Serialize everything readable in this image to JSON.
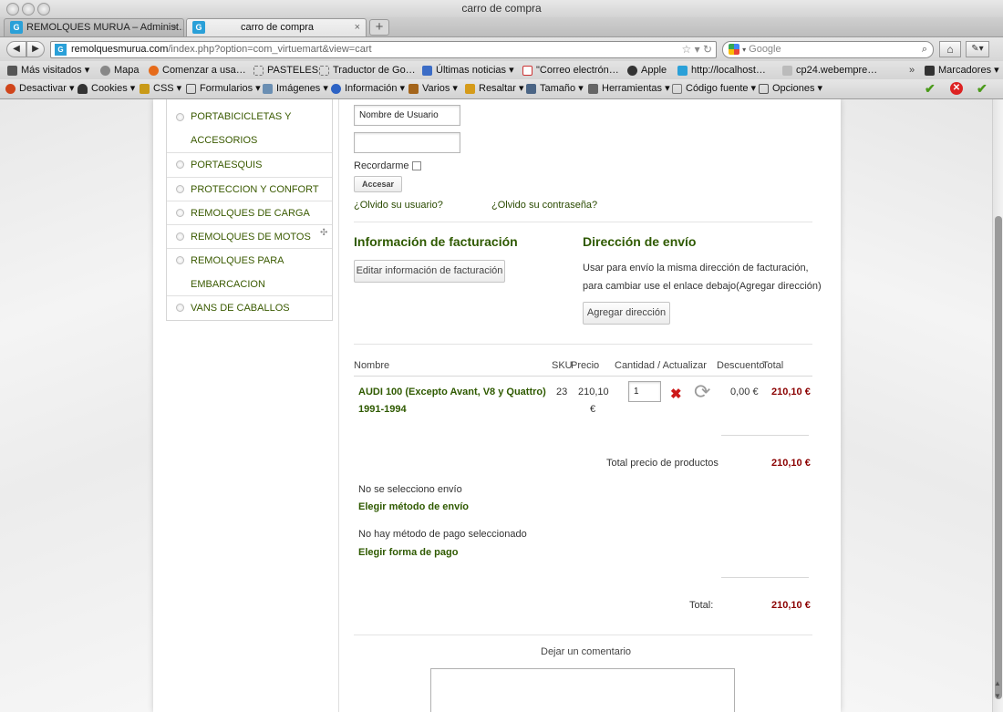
{
  "window": {
    "title": "carro de compra"
  },
  "tabs": [
    {
      "label": "REMOLQUES MURUA – Administ…",
      "favicon": "G"
    },
    {
      "label": "carro de compra",
      "favicon": "G"
    }
  ],
  "navbar": {
    "url_domain": "remolquesmurua.com",
    "url_path": "/index.php?option=com_virtuemart&view=cart",
    "search_placeholder": "Google"
  },
  "bookmarks": [
    {
      "label": "Más visitados ▾",
      "icon": "bookmarks-icon"
    },
    {
      "label": "Mapa",
      "icon": "globe-icon"
    },
    {
      "label": "Comenzar a usa…",
      "icon": "firefox-icon"
    },
    {
      "label": "PASTELES",
      "icon": "page-icon"
    },
    {
      "label": "Traductor de Go…",
      "icon": "page-icon"
    },
    {
      "label": "Últimas noticias ▾",
      "icon": "rss-icon"
    },
    {
      "label": "\"Correo electrón…",
      "icon": "gmail-icon"
    },
    {
      "label": "Apple",
      "icon": "apple-icon"
    },
    {
      "label": "http://localhost…",
      "icon": "g-icon"
    },
    {
      "label": "cp24.webempre…",
      "icon": "page-icon"
    },
    {
      "label": "Marcadores ▾",
      "icon": "bookmarks-folder-icon"
    }
  ],
  "devtoolbar": [
    {
      "label": "Desactivar ▾",
      "icon": "disable-icon"
    },
    {
      "label": "Cookies ▾",
      "icon": "person-icon"
    },
    {
      "label": "CSS ▾",
      "icon": "pencil-icon"
    },
    {
      "label": "Formularios ▾",
      "icon": "form-icon"
    },
    {
      "label": "Imágenes ▾",
      "icon": "image-icon"
    },
    {
      "label": "Información ▾",
      "icon": "info-icon"
    },
    {
      "label": "Varios ▾",
      "icon": "misc-icon"
    },
    {
      "label": "Resaltar ▾",
      "icon": "highlight-icon"
    },
    {
      "label": "Tamaño ▾",
      "icon": "resize-icon"
    },
    {
      "label": "Herramientas ▾",
      "icon": "tools-icon"
    },
    {
      "label": "Código fuente ▾",
      "icon": "source-icon"
    },
    {
      "label": "Opciones ▾",
      "icon": "options-icon"
    }
  ],
  "sidebar": {
    "items": [
      {
        "label": "PORTABICICLETAS Y ACCESORIOS"
      },
      {
        "label": "PORTAESQUIS"
      },
      {
        "label": "PROTECCION Y CONFORT"
      },
      {
        "label": "REMOLQUES DE CARGA"
      },
      {
        "label": "REMOLQUES DE MOTOS"
      },
      {
        "label": "REMOLQUES PARA EMBARCACION"
      },
      {
        "label": "VANS DE CABALLOS"
      }
    ]
  },
  "login": {
    "username_value": "Nombre de Usuario",
    "password_value": "",
    "remember_label": "Recordarme",
    "submit_label": "Accesar",
    "forgot_user": "¿Olvido su usuario?",
    "forgot_password": "¿Olvido su contraseña?"
  },
  "billing": {
    "heading": "Información de facturación",
    "edit_button": "Editar información de facturación"
  },
  "shipping": {
    "heading": "Dirección de envío",
    "text_line1": "Usar para envío la misma dirección de facturación,",
    "text_line2": "para cambiar use el enlace debajo(Agregar dirección)",
    "add_button": "Agregar dirección"
  },
  "cart": {
    "headers": {
      "name": "Nombre",
      "sku": "SKU",
      "price": "Precio",
      "qty": "Cantidad / Actualizar",
      "discount": "Descuento",
      "total": "Total"
    },
    "item": {
      "name_line1": "AUDI 100 (Excepto Avant, V8 y Quattro)",
      "name_line2": "1991-1994",
      "sku": "23",
      "price_line1": "210,10",
      "price_line2": "€",
      "quantity": "1",
      "discount": "0,00 €",
      "total": "210,10 €"
    },
    "products_total_label": "Total precio de productos",
    "products_total_value": "210,10 €",
    "no_shipping": "No se selecciono envío",
    "choose_shipping": "Elegir método de envío",
    "no_payment": "No hay método de pago seleccionado",
    "choose_payment": "Elegir forma de pago",
    "grand_total_label": "Total:",
    "grand_total_value": "210,10 €",
    "comment_label": "Dejar un comentario"
  },
  "colors": {
    "link_green": "#2f5a00",
    "price_red": "#8b0000",
    "delete_red": "#cc1a1a"
  }
}
